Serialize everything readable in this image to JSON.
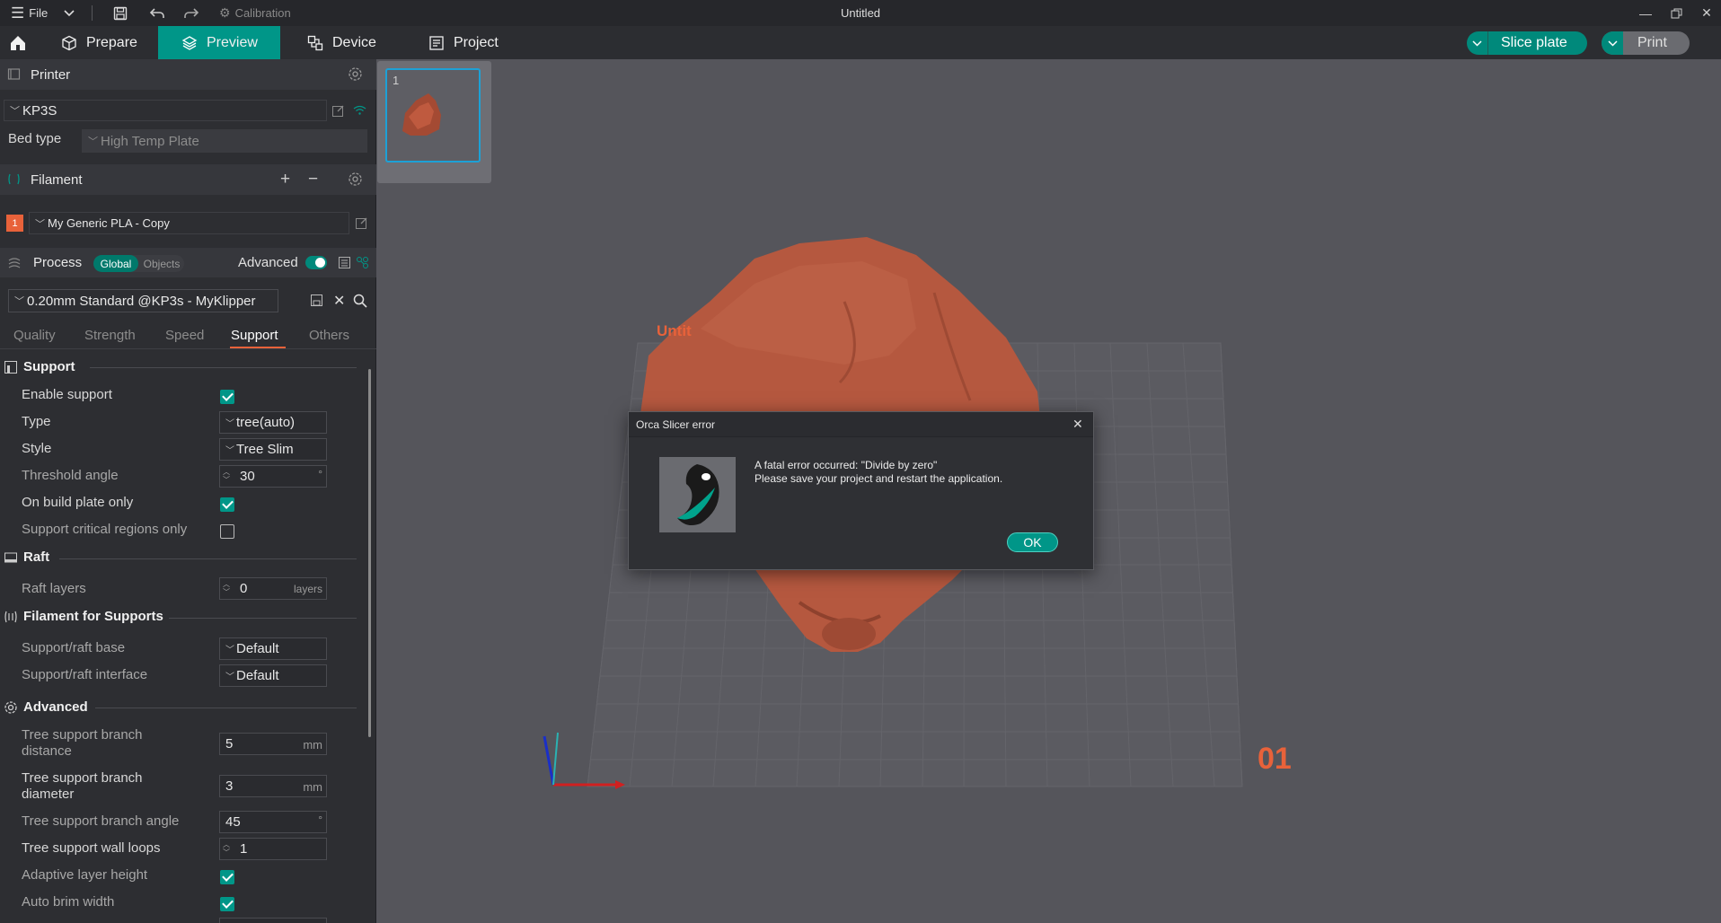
{
  "titlebar": {
    "menu_label": "File",
    "calibration_label": "Calibration",
    "window_title": "Untitled"
  },
  "tabs": {
    "prepare": "Prepare",
    "preview": "Preview",
    "device": "Device",
    "project": "Project"
  },
  "actions": {
    "slice_label": "Slice plate",
    "print_label": "Print"
  },
  "printer": {
    "section_title": "Printer",
    "name": "KP3S",
    "bed_type_label": "Bed type",
    "bed_type_value": "High Temp Plate"
  },
  "filament": {
    "section_title": "Filament",
    "slot_number": "1",
    "preset": "My Generic PLA - Copy"
  },
  "process": {
    "section_title": "Process",
    "scope_global": "Global",
    "scope_objects": "Objects",
    "advanced_label": "Advanced",
    "preset": "0.20mm Standard @KP3s - MyKlipper",
    "tabs": [
      "Quality",
      "Strength",
      "Speed",
      "Support",
      "Others"
    ]
  },
  "support": {
    "group_title": "Support",
    "enable_support_label": "Enable support",
    "type_label": "Type",
    "type_value": "tree(auto)",
    "style_label": "Style",
    "style_value": "Tree Slim",
    "threshold_label": "Threshold angle",
    "threshold_value": "30",
    "threshold_unit": "°",
    "build_plate_only_label": "On build plate only",
    "critical_regions_label": "Support critical regions only"
  },
  "raft": {
    "group_title": "Raft",
    "layers_label": "Raft layers",
    "layers_value": "0",
    "layers_unit": "layers"
  },
  "filament_supports": {
    "group_title": "Filament for Supports",
    "base_label": "Support/raft base",
    "base_value": "Default",
    "interface_label": "Support/raft interface",
    "interface_value": "Default"
  },
  "advanced": {
    "group_title": "Advanced",
    "branch_distance_label": "Tree support branch distance",
    "branch_distance_value": "5",
    "branch_distance_unit": "mm",
    "branch_diameter_label": "Tree support branch diameter",
    "branch_diameter_value": "3",
    "branch_diameter_unit": "mm",
    "branch_angle_label": "Tree support branch angle",
    "branch_angle_value": "45",
    "branch_angle_unit": "°",
    "wall_loops_label": "Tree support wall loops",
    "wall_loops_value": "1",
    "adaptive_layer_label": "Adaptive layer height",
    "auto_brim_label": "Auto brim width"
  },
  "viewport": {
    "plate_thumb_number": "1",
    "plate_label_partial": "Untit",
    "plate_index": "01"
  },
  "dialog": {
    "title": "Orca Slicer error",
    "message_line1": "A fatal error occurred: \"Divide by zero\"",
    "message_line2": "Please save your project and restart the application.",
    "ok_label": "OK"
  },
  "colors": {
    "accent": "#009688",
    "model": "#b5583f",
    "panel": "#2d2e32",
    "viewport": "#55555b"
  }
}
